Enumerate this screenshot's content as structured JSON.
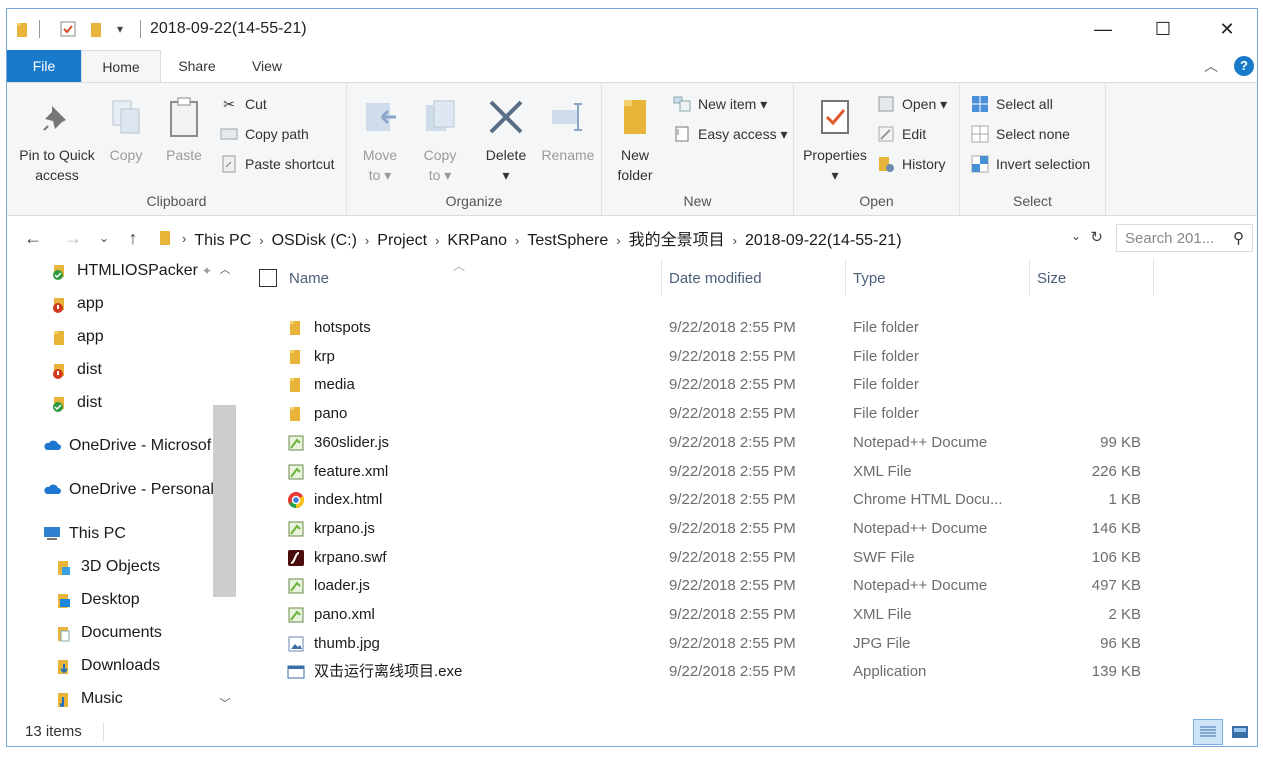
{
  "window": {
    "title": "2018-09-22(14-55-21)"
  },
  "window_controls": {
    "minimize": "—",
    "maximize": "☐",
    "close": "✕"
  },
  "tabs": {
    "file": "File",
    "home": "Home",
    "share": "Share",
    "view": "View"
  },
  "ribbon": {
    "clipboard": {
      "label": "Clipboard",
      "pin": "Pin to Quick access",
      "pin_l1": "Pin to Quick",
      "pin_l2": "access",
      "copy": "Copy",
      "paste": "Paste",
      "cut": "Cut",
      "copy_path": "Copy path",
      "paste_shortcut": "Paste shortcut"
    },
    "organize": {
      "label": "Organize",
      "move_l1": "Move",
      "move_l2": "to ▾",
      "copy_l1": "Copy",
      "copy_l2": "to ▾",
      "delete": "Delete",
      "delete_arrow": "▾",
      "rename": "Rename"
    },
    "new": {
      "label": "New",
      "folder_l1": "New",
      "folder_l2": "folder",
      "new_item": "New item ▾",
      "easy_access": "Easy access ▾"
    },
    "open": {
      "label": "Open",
      "properties": "Properties",
      "properties_arrow": "▾",
      "open": "Open ▾",
      "edit": "Edit",
      "history": "History"
    },
    "select": {
      "label": "Select",
      "select_all": "Select all",
      "select_none": "Select none",
      "invert": "Invert selection"
    }
  },
  "address": {
    "crumbs": [
      "This PC",
      "OSDisk (C:)",
      "Project",
      "KRPano",
      "TestSphere",
      "我的全景项目",
      "2018-09-22(14-55-21)"
    ],
    "search_placeholder": "Search 201..."
  },
  "nav_pane": [
    {
      "label": "HTMLIOSPacker",
      "icon": "green-check-folder",
      "pinned": true
    },
    {
      "label": "app",
      "icon": "red-alert-folder"
    },
    {
      "label": "app",
      "icon": "folder"
    },
    {
      "label": "dist",
      "icon": "red-alert-folder"
    },
    {
      "label": "dist",
      "icon": "green-check-folder"
    },
    {
      "label": "OneDrive - Microsof",
      "icon": "cloud"
    },
    {
      "label": "OneDrive - Personal",
      "icon": "cloud"
    },
    {
      "label": "This PC",
      "icon": "computer"
    },
    {
      "label": "3D Objects",
      "icon": "3d-folder"
    },
    {
      "label": "Desktop",
      "icon": "desktop-folder"
    },
    {
      "label": "Documents",
      "icon": "documents-folder"
    },
    {
      "label": "Downloads",
      "icon": "downloads-folder"
    },
    {
      "label": "Music",
      "icon": "music-folder"
    }
  ],
  "columns": {
    "name": "Name",
    "date": "Date modified",
    "type": "Type",
    "size": "Size"
  },
  "files": [
    {
      "name": "hotspots",
      "date": "9/22/2018 2:55 PM",
      "type": "File folder",
      "size": "",
      "icon": "folder"
    },
    {
      "name": "krp",
      "date": "9/22/2018 2:55 PM",
      "type": "File folder",
      "size": "",
      "icon": "folder"
    },
    {
      "name": "media",
      "date": "9/22/2018 2:55 PM",
      "type": "File folder",
      "size": "",
      "icon": "folder"
    },
    {
      "name": "pano",
      "date": "9/22/2018 2:55 PM",
      "type": "File folder",
      "size": "",
      "icon": "folder"
    },
    {
      "name": "360slider.js",
      "date": "9/22/2018 2:55 PM",
      "type": "Notepad++ Docume",
      "size": "99 KB",
      "icon": "notepad"
    },
    {
      "name": "feature.xml",
      "date": "9/22/2018 2:55 PM",
      "type": "XML File",
      "size": "226 KB",
      "icon": "notepad"
    },
    {
      "name": "index.html",
      "date": "9/22/2018 2:55 PM",
      "type": "Chrome HTML Docu...",
      "size": "1 KB",
      "icon": "chrome"
    },
    {
      "name": "krpano.js",
      "date": "9/22/2018 2:55 PM",
      "type": "Notepad++ Docume",
      "size": "146 KB",
      "icon": "notepad"
    },
    {
      "name": "krpano.swf",
      "date": "9/22/2018 2:55 PM",
      "type": "SWF File",
      "size": "106 KB",
      "icon": "flash"
    },
    {
      "name": "loader.js",
      "date": "9/22/2018 2:55 PM",
      "type": "Notepad++ Docume",
      "size": "497 KB",
      "icon": "notepad"
    },
    {
      "name": "pano.xml",
      "date": "9/22/2018 2:55 PM",
      "type": "XML File",
      "size": "2 KB",
      "icon": "notepad"
    },
    {
      "name": "thumb.jpg",
      "date": "9/22/2018 2:55 PM",
      "type": "JPG File",
      "size": "96 KB",
      "icon": "image"
    },
    {
      "name": "双击运行离线项目.exe",
      "date": "9/22/2018 2:55 PM",
      "type": "Application",
      "size": "139 KB",
      "icon": "app"
    }
  ],
  "status": {
    "items": "13 items"
  },
  "colors": {
    "accent": "#1979ca",
    "folder": "#e8b43a",
    "header_text": "#4c607a"
  }
}
